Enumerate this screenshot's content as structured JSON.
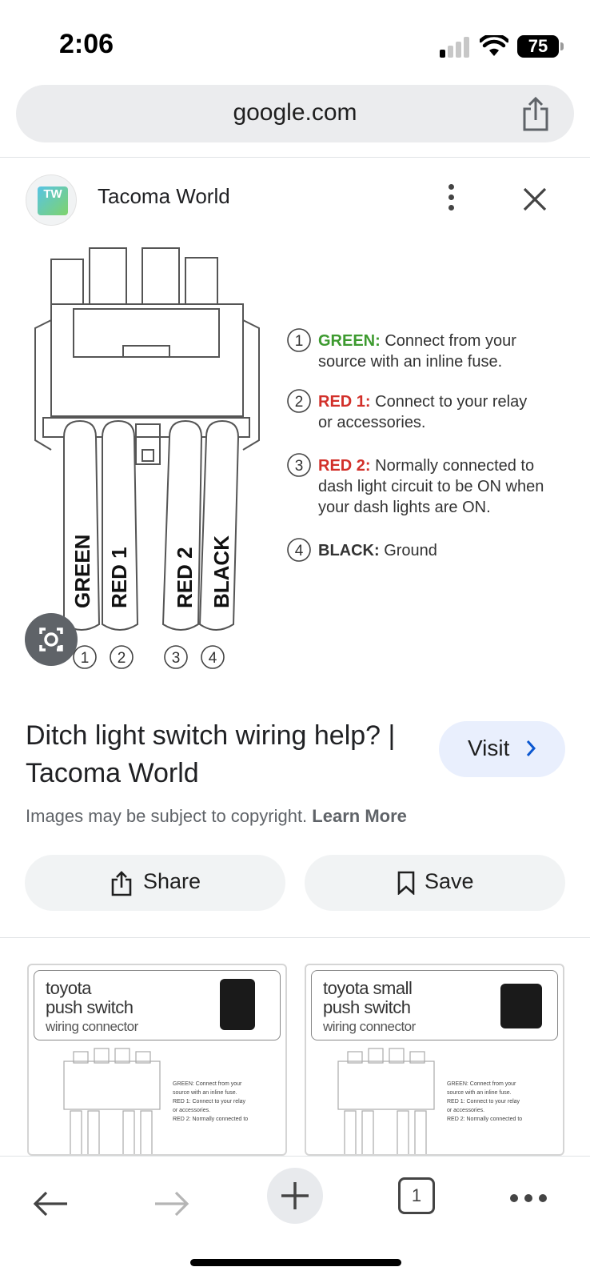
{
  "status": {
    "time": "2:06",
    "battery": "75"
  },
  "url_bar": {
    "domain": "google.com"
  },
  "source": {
    "name": "Tacoma World",
    "favicon_text": "TW"
  },
  "diagram": {
    "wires": [
      "GREEN",
      "RED 1",
      "RED 2",
      "BLACK"
    ],
    "pin_numbers": [
      "1",
      "2",
      "3",
      "4"
    ],
    "legend": [
      {
        "num": "1",
        "key": "GREEN:",
        "text_line1": "Connect from your",
        "text_line2": "source with an inline fuse.",
        "text_line3": "",
        "color": "#3d9a2f"
      },
      {
        "num": "2",
        "key": "RED 1:",
        "text_line1": "Connect to your relay",
        "text_line2": "or accessories.",
        "text_line3": "",
        "color": "#d2302a"
      },
      {
        "num": "3",
        "key": "RED 2:",
        "text_line1": "Normally connected to",
        "text_line2": "dash light circuit to be ON when",
        "text_line3": "your dash lights are ON.",
        "color": "#d2302a"
      },
      {
        "num": "4",
        "key": "BLACK:",
        "text_line1": "Ground",
        "text_line2": "",
        "text_line3": "",
        "color": "#333333"
      }
    ]
  },
  "result": {
    "title": "Ditch light switch wiring help? | Tacoma World",
    "visit_label": "Visit",
    "copyright_text": "Images may be subject to copyright.",
    "learn_more": "Learn More"
  },
  "actions": {
    "share": "Share",
    "save": "Save"
  },
  "related": [
    {
      "line1": "toyota",
      "line2": "push switch",
      "line3": "wiring connector",
      "legend": [
        "GREEN: Connect from your",
        "source with an inline fuse.",
        "RED 1: Connect to your relay",
        "or accessories.",
        "RED 2: Normally connected to"
      ]
    },
    {
      "line1": "toyota small",
      "line2": "push switch",
      "line3": "wiring connector",
      "legend": [
        "GREEN: Connect from your",
        "source with an inline fuse.",
        "RED 1: Connect to your relay",
        "or accessories.",
        "RED 2: Normally connected to"
      ]
    }
  ],
  "bottom_bar": {
    "tab_count": "1"
  },
  "colors": {
    "accent": "#0b57d0",
    "visit_bg": "#e9effd",
    "chip_bg": "#f1f3f4"
  }
}
